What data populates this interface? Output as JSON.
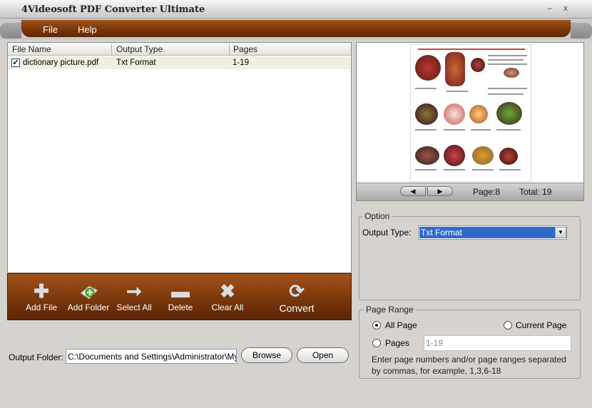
{
  "window": {
    "title": "4Videosoft PDF Converter Ultimate",
    "min_glyph": "–",
    "close_glyph": "x"
  },
  "menu": {
    "file": "File",
    "help": "Help"
  },
  "file_list": {
    "columns": [
      "File Name",
      "Output Type",
      "Pages"
    ],
    "rows": [
      {
        "checked": true,
        "check_glyph": "✓",
        "name": "dictionary picture.pdf",
        "output_type": "Txt Format",
        "pages": "1-19"
      }
    ]
  },
  "toolbar": {
    "add_file": "Add File",
    "add_folder": "Add Folder",
    "select_all": "Select All",
    "delete": "Delete",
    "clear_all": "Clear All",
    "convert": "Convert"
  },
  "icons": {
    "add_file": "plus-icon",
    "add_folder": "folder-add-icon",
    "select_all": "arrow-right-icon",
    "delete": "minus-icon",
    "clear_all": "x-icon",
    "convert": "refresh-icon"
  },
  "output": {
    "label": "Output Folder:",
    "path": "C:\\Documents and Settings\\Administrator\\My Documents",
    "browse": "Browse",
    "open": "Open"
  },
  "preview": {
    "page_text": "Page:8",
    "total_text": "Total: 19",
    "prev_glyph": "◀",
    "next_glyph": "▶"
  },
  "option": {
    "group_title": "Option",
    "output_type_label": "Output Type:",
    "output_type_value": "Txt Format",
    "dropdown_glyph": "▼"
  },
  "page_range": {
    "group_title": "Page Range",
    "all_pages": "All Page",
    "current_page": "Current Page",
    "pages": "Pages",
    "pages_value": "1-19",
    "hint": "Enter page numbers and/or page ranges separated by commas, for example, 1,3,6-18",
    "selected": "all"
  },
  "colors": {
    "accent": "#7a3608",
    "selection": "#316ac5"
  }
}
